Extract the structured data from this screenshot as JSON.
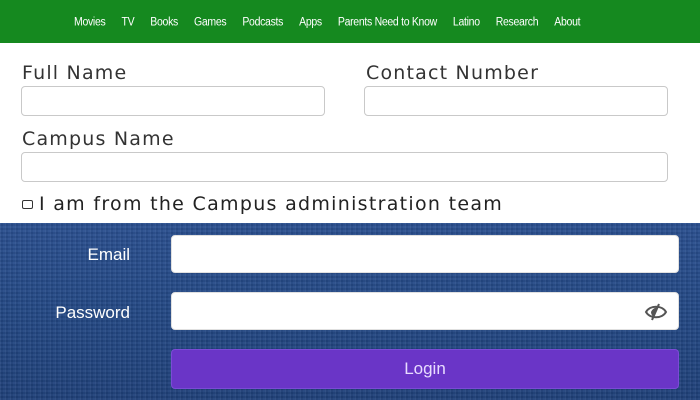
{
  "nav": {
    "items": [
      "Movies",
      "TV",
      "Books",
      "Games",
      "Podcasts",
      "Apps",
      "Parents Need to Know",
      "Latino",
      "Research",
      "About"
    ]
  },
  "form": {
    "full_name_label": "Full Name",
    "full_name_value": "",
    "contact_number_label": "Contact Number",
    "contact_number_value": "",
    "campus_name_label": "Campus Name",
    "campus_name_value": "",
    "admin_checkbox_label": "I am from the Campus administration team",
    "admin_checkbox_checked": false
  },
  "login": {
    "email_label": "Email",
    "email_value": "",
    "password_label": "Password",
    "password_value": "",
    "password_toggle_icon": "eye-slash-icon",
    "login_button_label": "Login"
  },
  "colors": {
    "nav_green": "#15891f",
    "panel_blue": "#234884",
    "button_purple": "#6a35c7"
  }
}
